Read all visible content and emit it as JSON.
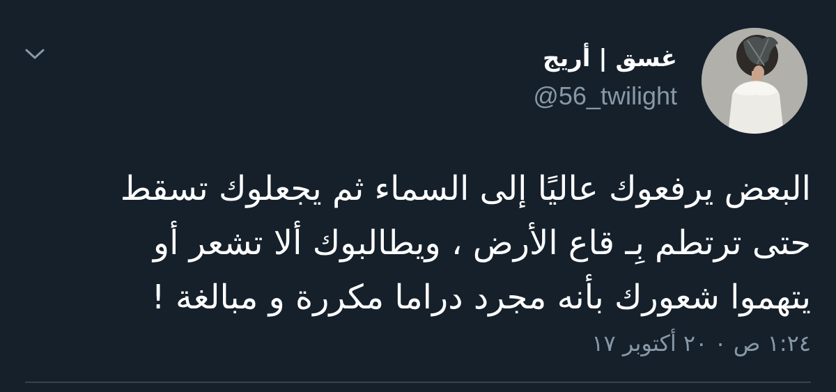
{
  "tweet": {
    "author": {
      "display_name": "غسق | أريج",
      "handle": "@56_twilight"
    },
    "text_lines": [
      "البعض يرفعوك عاليًا إلى السماء ثم يجعلوك تسقط",
      "حتى ترتطم بِـ قاع الأرض ، ويطالبوك ألا تشعر  أو",
      "يتهموا شعورك بأنه مجرد دراما مكررة و مبالغة !"
    ],
    "timestamp": "١:٢٤ ص ٠ ٢٠ أكتوبر ١٧",
    "menu_icon": "chevron-down-icon"
  },
  "theme": {
    "background": "#15202b",
    "text": "#ffffff",
    "secondary_text": "#8899a6",
    "divider": "#38444d"
  }
}
